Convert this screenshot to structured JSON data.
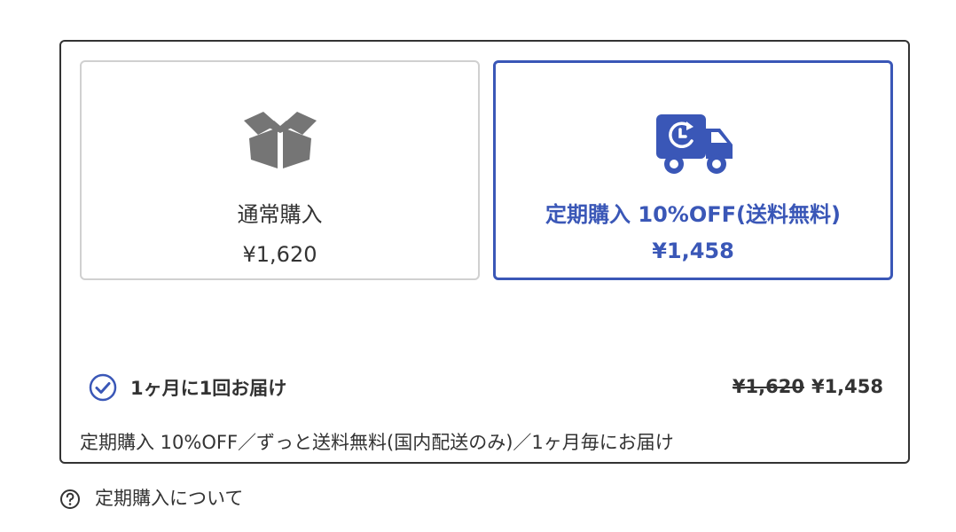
{
  "options": {
    "normal": {
      "icon": "box-open-icon",
      "label": "通常購入",
      "price": "¥1,620",
      "selected": false
    },
    "subscription": {
      "icon": "delivery-truck-clock-icon",
      "label": "定期購入 10%OFF(送料無料)",
      "price": "¥1,458",
      "selected": true
    }
  },
  "frequency": {
    "icon": "check-circle-icon",
    "label": "1ヶ月に1回お届け",
    "old_price": "¥1,620",
    "new_price": "¥1,458"
  },
  "description": "定期購入 10%OFF／ずっと送料無料(国内配送のみ)／1ヶ月毎にお届け",
  "help": {
    "icon": "question-circle-icon",
    "label": "定期購入について"
  },
  "colors": {
    "accent": "#3a57b7",
    "icon_gray": "#757575",
    "border": "#333333"
  }
}
